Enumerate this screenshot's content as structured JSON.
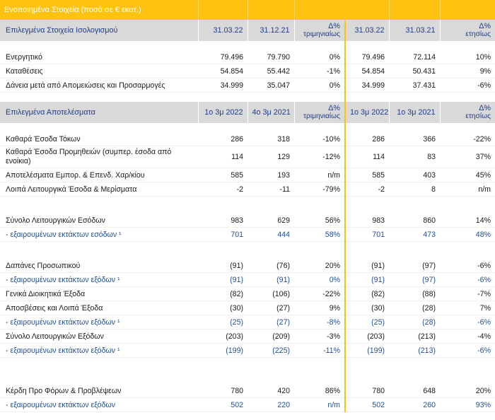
{
  "title": "Ενοποιημένα Στοιχεία (ποσά σε € εκατ.)",
  "balance": {
    "header": {
      "label": "Επιλεγμένα Στοιχεία Ισολογισμού",
      "c1": "31.03.22",
      "c2": "31.12.21",
      "c3a": "Δ%",
      "c3b": "τριμηνιαίως",
      "c4": "31.03.22",
      "c5": "31.03.21",
      "c6a": "Δ%",
      "c6b": "ετησίως"
    },
    "rows": [
      {
        "label": "Ενεργητικό",
        "v": [
          "79.496",
          "79.790",
          "0%",
          "79.496",
          "72.114",
          "10%"
        ]
      },
      {
        "label": "Καταθέσεις",
        "v": [
          "54.854",
          "55.442",
          "-1%",
          "54.854",
          "50.431",
          "9%"
        ]
      },
      {
        "label": "Δάνεια μετά από Απομειώσεις και Προσαρμογές",
        "v": [
          "34.999",
          "35.047",
          "0%",
          "34.999",
          "37.431",
          "-6%"
        ]
      }
    ]
  },
  "results": {
    "header": {
      "label": "Επιλεγμένα Αποτελέσματα",
      "c1": "1ο 3μ 2022",
      "c2": "4ο 3μ 2021",
      "c3a": "Δ%",
      "c3b": "τριμηνιαίως",
      "c4": "1ο 3μ 2022",
      "c5": "1ο 3μ 2021",
      "c6a": "Δ%",
      "c6b": "ετησίως"
    },
    "group1": [
      {
        "label": "Καθαρά Έσοδα Τόκων",
        "v": [
          "286",
          "318",
          "-10%",
          "286",
          "366",
          "-22%"
        ]
      },
      {
        "label": "Καθαρά Έσοδα Προμηθειών (συμπερ. έσοδα από ενοίκια)",
        "v": [
          "114",
          "129",
          "-12%",
          "114",
          "83",
          "37%"
        ]
      },
      {
        "label": "Αποτελέσματα Εμπορ. & Επενδ. Χαρ/κίου",
        "v": [
          "585",
          "193",
          "n/m",
          "585",
          "403",
          "45%"
        ]
      },
      {
        "label": "Λοιπά Λειτουργικά Έσοδα & Μερίσματα",
        "v": [
          "-2",
          "-11",
          "-79%",
          "-2",
          "8",
          "n/m"
        ]
      }
    ],
    "group2": [
      {
        "label": "Σύνολο Λειτουργικών Εσόδων",
        "v": [
          "983",
          "629",
          "56%",
          "983",
          "860",
          "14%"
        ]
      },
      {
        "label": "- εξαιρουμένων εκτάκτων εσόδων ¹",
        "v": [
          "701",
          "444",
          "58%",
          "701",
          "473",
          "48%"
        ]
      }
    ],
    "group3": [
      {
        "label": "Δαπάνες Προσωπικού",
        "v": [
          "(91)",
          "(76)",
          "20%",
          "(91)",
          "(97)",
          "-6%"
        ]
      },
      {
        "label": "- εξαιρουμένων εκτάκτων εξόδων ¹",
        "v": [
          "(91)",
          "(91)",
          "0%",
          "(91)",
          "(97)",
          "-6%"
        ]
      },
      {
        "label": "Γενικά Διοικητικά Έξοδα",
        "v": [
          "(82)",
          "(106)",
          "-22%",
          "(82)",
          "(88)",
          "-7%"
        ]
      },
      {
        "label": "Αποσβέσεις και Λοιπά Έξοδα",
        "v": [
          "(30)",
          "(27)",
          "9%",
          "(30)",
          "(28)",
          "7%"
        ]
      },
      {
        "label": "- εξαιρουμένων εκτάκτων εξόδων ¹",
        "v": [
          "(25)",
          "(27)",
          "-8%",
          "(25)",
          "(28)",
          "-6%"
        ]
      },
      {
        "label": "Σύνολο Λειτουργικών Εξόδων",
        "v": [
          "(203)",
          "(209)",
          "-3%",
          "(203)",
          "(213)",
          "-4%"
        ]
      },
      {
        "label": "- εξαιρουμένων εκτάκτων εξόδων ¹",
        "v": [
          "(199)",
          "(225)",
          "-11%",
          "(199)",
          "(213)",
          "-6%"
        ]
      }
    ],
    "group4": [
      {
        "label": "Κέρδη Προ Φόρων & Προβλέψεων",
        "v": [
          "780",
          "420",
          "86%",
          "780",
          "648",
          "20%"
        ]
      },
      {
        "label": "- εξαιρουμένων εκτάκτων εξόδων",
        "v": [
          "502",
          "220",
          "n/m",
          "502",
          "260",
          "93%"
        ]
      }
    ]
  }
}
